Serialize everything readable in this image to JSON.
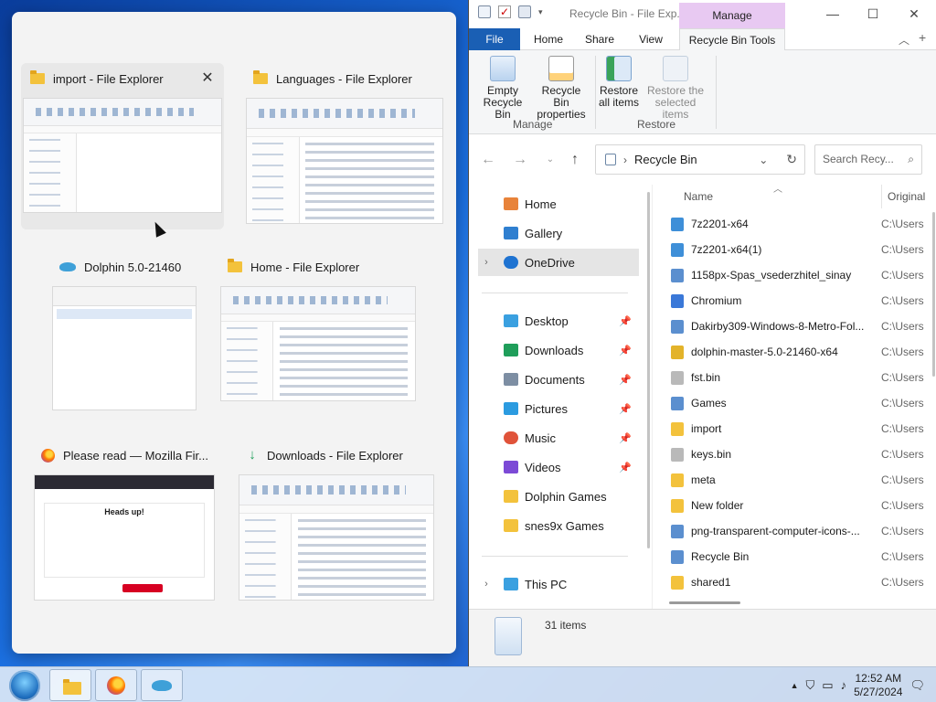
{
  "switcher": {
    "windows": [
      {
        "title": "import - File Explorer",
        "icon": "folder-icon"
      },
      {
        "title": "Languages - File Explorer",
        "icon": "folder-icon"
      },
      {
        "title": "Dolphin 5.0-21460",
        "icon": "dolphin-icon"
      },
      {
        "title": "Home - File Explorer",
        "icon": "folder-icon"
      },
      {
        "title": "Please read — Mozilla Fir...",
        "icon": "firefox-icon"
      },
      {
        "title": "Downloads - File Explorer",
        "icon": "downloads-icon"
      }
    ],
    "close_glyph": "✕",
    "firefox_preview_heading": "Heads up!"
  },
  "explorer": {
    "title": "Recycle Bin - File Exp...",
    "context_tab": "Manage",
    "tabs": [
      "File",
      "Home",
      "Share",
      "View",
      "Recycle Bin Tools"
    ],
    "ribbon": {
      "empty_bin": [
        "Empty",
        "Recycle Bin"
      ],
      "bin_props": [
        "Recycle Bin",
        "properties"
      ],
      "restore_all": [
        "Restore",
        "all items"
      ],
      "restore_selected": [
        "Restore the",
        "selected items"
      ],
      "group_manage": "Manage",
      "group_restore": "Restore"
    },
    "address": {
      "location": "Recycle Bin",
      "search_placeholder": "Search Recy..."
    },
    "nav": [
      {
        "label": "Home",
        "icon": "home-icon",
        "color": "#e8833a"
      },
      {
        "label": "Gallery",
        "icon": "gallery-icon",
        "color": "#2f7fd0"
      },
      {
        "label": "OneDrive",
        "icon": "cloud-icon",
        "color": "#1f73d1"
      },
      {
        "label": "Desktop",
        "icon": "desktop-icon",
        "color": "#3aa0e0"
      },
      {
        "label": "Downloads",
        "icon": "downloads-icon",
        "color": "#1f9e5a"
      },
      {
        "label": "Documents",
        "icon": "documents-icon",
        "color": "#7d8ea3"
      },
      {
        "label": "Pictures",
        "icon": "pictures-icon",
        "color": "#2b9be0"
      },
      {
        "label": "Music",
        "icon": "music-icon",
        "color": "#e0533a"
      },
      {
        "label": "Videos",
        "icon": "videos-icon",
        "color": "#7c4ad6"
      },
      {
        "label": "Dolphin Games",
        "icon": "folder-icon",
        "color": "#f3c23c"
      },
      {
        "label": "snes9x Games",
        "icon": "folder-icon",
        "color": "#f3c23c"
      },
      {
        "label": "This PC",
        "icon": "pc-icon",
        "color": "#3aa0e0"
      }
    ],
    "columns": {
      "name": "Name",
      "original": "Original"
    },
    "files": [
      {
        "name": "7z2201-x64",
        "original": "C:\\Users",
        "icon": "installer-icon",
        "color": "#3e8fd8"
      },
      {
        "name": "7z2201-x64(1)",
        "original": "C:\\Users",
        "icon": "installer-icon",
        "color": "#3e8fd8"
      },
      {
        "name": "1158px-Spas_vsederzhitel_sinay",
        "original": "C:\\Users",
        "icon": "image-file-icon",
        "color": "#5b8fcf"
      },
      {
        "name": "Chromium",
        "original": "C:\\Users",
        "icon": "chromium-icon",
        "color": "#3a78d8"
      },
      {
        "name": "Dakirby309-Windows-8-Metro-Fol...",
        "original": "C:\\Users",
        "icon": "image-file-icon",
        "color": "#5b8fcf"
      },
      {
        "name": "dolphin-master-5.0-21460-x64",
        "original": "C:\\Users",
        "icon": "archive-icon",
        "color": "#e3b32a"
      },
      {
        "name": "fst.bin",
        "original": "C:\\Users",
        "icon": "file-icon",
        "color": "#b9b9b9"
      },
      {
        "name": "Games",
        "original": "C:\\Users",
        "icon": "image-file-icon",
        "color": "#5b8fcf"
      },
      {
        "name": "import",
        "original": "C:\\Users",
        "icon": "folder-icon",
        "color": "#f3c23c"
      },
      {
        "name": "keys.bin",
        "original": "C:\\Users",
        "icon": "file-icon",
        "color": "#b9b9b9"
      },
      {
        "name": "meta",
        "original": "C:\\Users",
        "icon": "folder-icon",
        "color": "#f3c23c"
      },
      {
        "name": "New folder",
        "original": "C:\\Users",
        "icon": "folder-icon",
        "color": "#f3c23c"
      },
      {
        "name": "png-transparent-computer-icons-...",
        "original": "C:\\Users",
        "icon": "image-file-icon",
        "color": "#5b8fcf"
      },
      {
        "name": "Recycle Bin",
        "original": "C:\\Users",
        "icon": "image-file-icon",
        "color": "#5b8fcf"
      },
      {
        "name": "shared1",
        "original": "C:\\Users",
        "icon": "folder-icon",
        "color": "#f3c23c"
      }
    ],
    "status": {
      "count": "31 items"
    }
  },
  "taskbar": {
    "clock_time": "12:52 AM",
    "clock_date": "5/27/2024",
    "apps": [
      "File Explorer",
      "Firefox",
      "Dolphin"
    ]
  },
  "colors": {
    "accent": "#1a5fb4",
    "manage_tab": "#e8c9f2"
  }
}
